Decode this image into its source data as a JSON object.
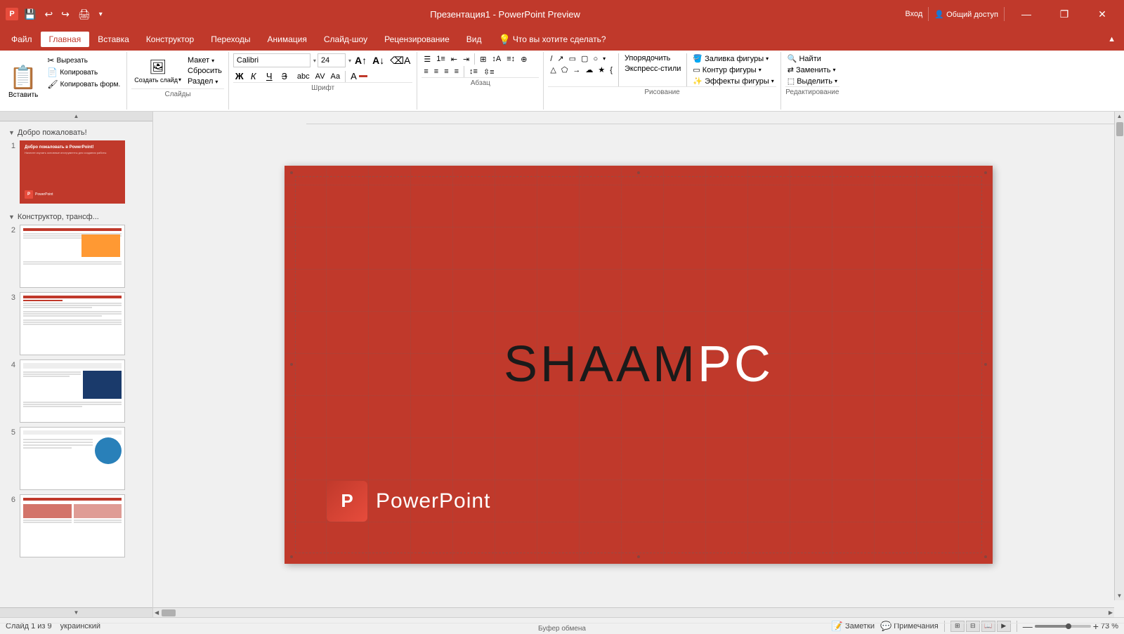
{
  "titlebar": {
    "app_title": "Презентация1 - PowerPoint Preview",
    "quick_access": [
      "💾",
      "↩",
      "↪",
      "🖨"
    ],
    "sign_in": "Вход",
    "share": "Общий доступ",
    "win_minimize": "—",
    "win_restore": "❐",
    "win_close": "✕"
  },
  "menu": {
    "items": [
      "Файл",
      "Главная",
      "Вставка",
      "Конструктор",
      "Переходы",
      "Анимация",
      "Слайд-шоу",
      "Рецензирование",
      "Вид",
      "Что вы хотите сделать?"
    ]
  },
  "ribbon": {
    "groups": [
      {
        "id": "clipboard",
        "label": "Буфер обмена"
      },
      {
        "id": "slides",
        "label": "Слайды"
      },
      {
        "id": "font",
        "label": "Шрифт"
      },
      {
        "id": "paragraph",
        "label": "Абзац"
      },
      {
        "id": "drawing",
        "label": "Рисование"
      },
      {
        "id": "editing",
        "label": "Редактирование"
      }
    ],
    "font_name": "Calibri",
    "font_size": "24",
    "paste_label": "Вставить",
    "create_slide_label": "Создать слайд",
    "reset_label": "Сбросить",
    "section_label": "Раздел",
    "layout_label": "Макет",
    "find_label": "Найти",
    "replace_label": "Заменить",
    "select_label": "Выделить",
    "fill_label": "Заливка фигуры",
    "outline_label": "Контур фигуры",
    "effect_label": "Эффекты фигуры",
    "arrange_label": "Упорядочить",
    "express_label": "Экспресс-стили"
  },
  "slides": {
    "section1": "Добро пожаловать!",
    "section2": "Конструктор, трансф...",
    "items": [
      {
        "num": "1",
        "section": "welcome"
      },
      {
        "num": "2",
        "section": "designer"
      },
      {
        "num": "3",
        "section": "designer"
      },
      {
        "num": "4",
        "section": "designer"
      },
      {
        "num": "5",
        "section": "designer"
      },
      {
        "num": "6",
        "section": "designer"
      }
    ]
  },
  "slide": {
    "brand_part1": "SHAAM",
    "brand_part2": "PC",
    "powerpoint_label": "PowerPoint",
    "pp_icon": "P"
  },
  "statusbar": {
    "slide_info": "Слайд 1 из 9",
    "language": "украинский",
    "notes_label": "Заметки",
    "comments_label": "Примечания",
    "zoom": "73 %",
    "zoom_minus": "—",
    "zoom_plus": "+"
  }
}
